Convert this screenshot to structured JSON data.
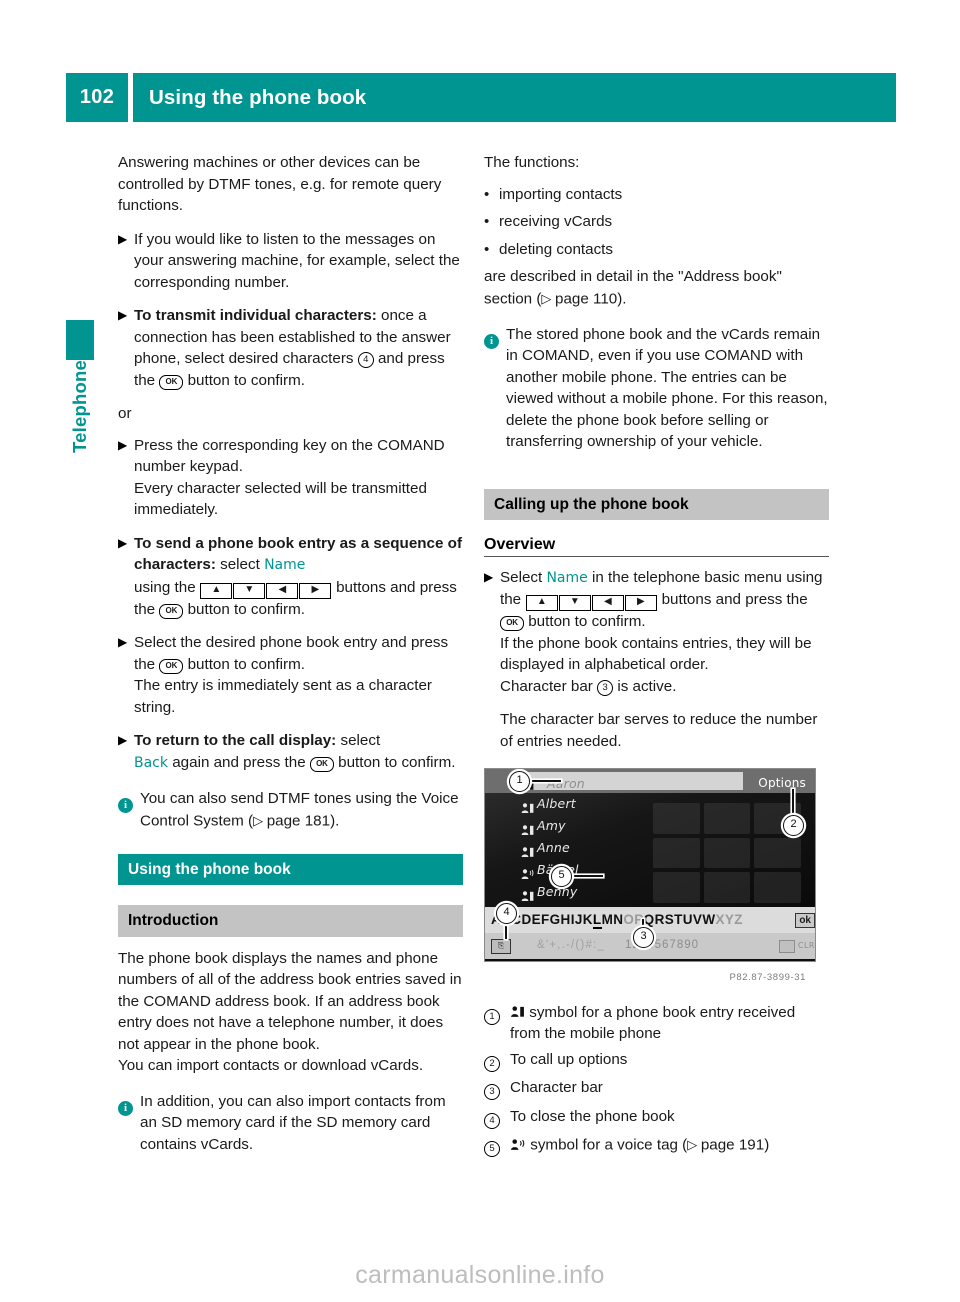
{
  "header": {
    "page_number": "102",
    "title": "Using the phone book"
  },
  "side_tab": {
    "label": "Telephone"
  },
  "left_column": {
    "intro_paragraph": "Answering machines or other devices can be controlled by DTMF tones, e.g. for remote query functions.",
    "step_listen": "If you would like to listen to the messages on your answering machine, for example, select the corresponding number.",
    "step_transmit_bold": "To transmit individual characters:",
    "step_transmit_rest_a": "once a connection has been established to the answer phone, select desired characters",
    "step_transmit_marker": "4",
    "step_transmit_rest_b": "and press the",
    "step_transmit_ok": "OK",
    "step_transmit_rest_c": "button to confirm.",
    "or_label": "or",
    "step_keypad": "Press the corresponding key on the COMAND number keypad.",
    "step_keypad_note": "Every character selected will be transmitted immediately.",
    "step_sequence_bold": "To send a phone book entry as a sequence of characters:",
    "step_sequence_select": "select",
    "step_sequence_menu": "Name",
    "step_sequence_using": "using the",
    "step_sequence_buttons": "buttons and press the",
    "step_sequence_ok": "OK",
    "step_sequence_confirm": "button to confirm.",
    "step_select_entry": "Select the desired phone book entry and press the",
    "step_select_ok": "OK",
    "step_select_confirm": "button to confirm.",
    "step_select_note": "The entry is immediately sent as a character string.",
    "step_return_bold": "To return to the call display:",
    "step_return_select": "select",
    "step_return_menu": "Back",
    "step_return_again": "again and press the",
    "step_return_ok": "OK",
    "step_return_confirm": "button to confirm.",
    "note_dtmf_a": "You can also send DTMF tones using the Voice Control System (",
    "note_dtmf_pageref": "page 181",
    "note_dtmf_b": ").",
    "heading_teal": "Using the phone book",
    "heading_gray": "Introduction",
    "intro_body": "The phone book displays the names and phone numbers of all of the address book entries saved in the COMAND address book. If an address book entry does not have a telephone number, it does not appear in the phone book.",
    "import_line": "You can import contacts or download vCards.",
    "note_sd": "In addition, you can also import contacts from an SD memory card if the SD memory card contains vCards."
  },
  "right_column": {
    "functions_label": "The functions:",
    "functions": [
      "importing contacts",
      "receiving vCards",
      "deleting contacts"
    ],
    "described_a": "are described in detail in the \"Address book\" section (",
    "described_pageref": "page 110",
    "described_b": ").",
    "note_stored": "The stored phone book and the vCards remain in COMAND, even if you use COMAND with another mobile phone. The entries can be viewed without a mobile phone. For this reason, delete the phone book before selling or transferring ownership of your vehicle.",
    "heading_gray": "Calling up the phone book",
    "heading_overview": "Overview",
    "step_select_a": "Select",
    "step_select_menu": "Name",
    "step_select_b": "in the telephone basic menu using the",
    "step_select_c": "buttons and press the",
    "step_select_ok": "OK",
    "step_select_d": "button to confirm.",
    "step_select_note": "If the phone book contains entries, they will be displayed in alphabetical order.",
    "charbar_note_a": "Character bar",
    "charbar_note_marker": "3",
    "charbar_note_b": "is active.",
    "charbar_purpose": "The character bar serves to reduce the number of entries needed."
  },
  "screenshot": {
    "selected_entry": "Aaron",
    "options_label": "Options",
    "entries": [
      "Albert",
      "Amy",
      "Anne",
      "Bärbel",
      "Benny"
    ],
    "charbar_letters": "ABCDEFGHIJKLMNOPQRSTUVWXYZ",
    "charbar_active_letter": "L",
    "charbar_dim_from": "O",
    "charbar_ok": "ok",
    "symbar_symbols": "&'+,.-/()#:_",
    "symbar_numbers": "1234567890",
    "symbar_clear": "CLR",
    "callouts": [
      "1",
      "2",
      "3",
      "4",
      "5"
    ],
    "caption": "P82.87-3899-31"
  },
  "legend": [
    {
      "num": "1",
      "icon": "person-phone-icon",
      "text": "symbol for a phone book entry received from the mobile phone"
    },
    {
      "num": "2",
      "icon": "",
      "text": "To call up options"
    },
    {
      "num": "3",
      "icon": "",
      "text": "Character bar"
    },
    {
      "num": "4",
      "icon": "",
      "text": "To close the phone book"
    },
    {
      "num": "5",
      "icon": "person-voice-icon",
      "text_a": "symbol for a voice tag (",
      "pageref": "page 191",
      "text_b": ")"
    }
  ],
  "watermark": "carmanualsonline.info",
  "colors": {
    "teal": "#009591",
    "gray_heading": "#c3c3c3"
  }
}
